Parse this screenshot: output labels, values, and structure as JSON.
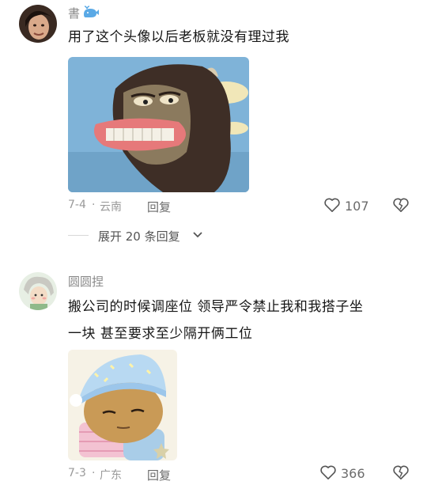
{
  "comments": [
    {
      "username": "書",
      "badge_icon": "whale-icon",
      "text": "用了这个头像以后老板就没有理过我",
      "date": "7-4",
      "location": "云南",
      "reply_label": "回复",
      "likes": "107",
      "expand_label": "展开 20 条回复"
    },
    {
      "username": "圆圆捏",
      "text_line1": "搬公司的时候调座位 领导严令禁止我和我搭子坐",
      "text_line2": "一块 甚至要求至少隔开俩工位",
      "date": "7-3",
      "location": "广东",
      "reply_label": "回复",
      "likes": "366"
    }
  ],
  "separator": "·"
}
